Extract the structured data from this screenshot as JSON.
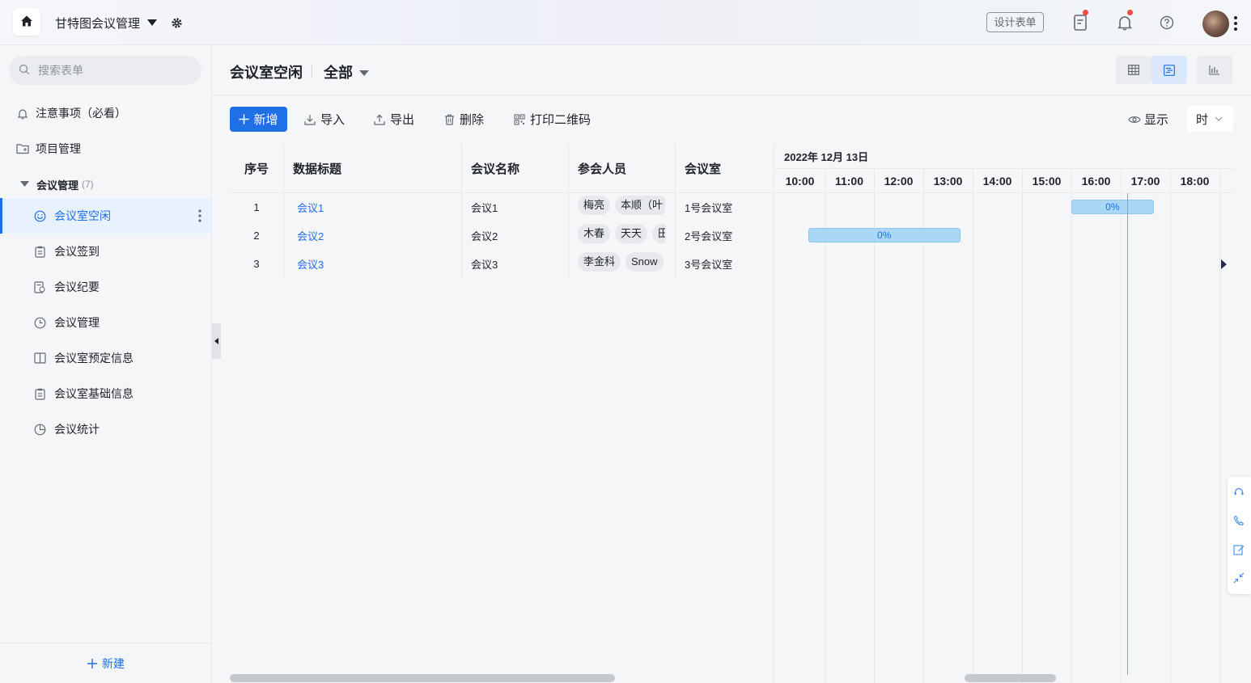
{
  "app": {
    "title": "甘特图会议管理",
    "design_form_label": "设计表单"
  },
  "sidebar": {
    "search_placeholder": "搜索表单",
    "top_items": [
      {
        "label": "注意事项（必看）",
        "icon": "bell-icon"
      },
      {
        "label": "项目管理",
        "icon": "folder-icon"
      }
    ],
    "group": {
      "label": "会议管理",
      "count": "(7)"
    },
    "items": [
      {
        "label": "会议室空闲",
        "icon": "smile-icon"
      },
      {
        "label": "会议签到",
        "icon": "clipboard-icon"
      },
      {
        "label": "会议纪要",
        "icon": "document-icon"
      },
      {
        "label": "会议管理",
        "icon": "clock-icon"
      },
      {
        "label": "会议室预定信息",
        "icon": "columns-icon"
      },
      {
        "label": "会议室基础信息",
        "icon": "clipboard-icon"
      },
      {
        "label": "会议统计",
        "icon": "pie-chart-icon"
      }
    ],
    "new_label": "新建"
  },
  "header": {
    "title": "会议室空闲",
    "view": "全部"
  },
  "toolbar": {
    "add": "新增",
    "import": "导入",
    "export": "导出",
    "delete": "删除",
    "print_qr": "打印二维码",
    "display": "显示",
    "time_unit": "时"
  },
  "table": {
    "columns": [
      "序号",
      "数据标题",
      "会议名称",
      "参会人员",
      "会议室"
    ],
    "rows": [
      {
        "no": "1",
        "title": "会议1",
        "meeting": "会议1",
        "attendees": [
          "梅亮",
          "本顺（叶"
        ],
        "room": "1号会议室"
      },
      {
        "no": "2",
        "title": "会议2",
        "meeting": "会议2",
        "attendees": [
          "木春",
          "天天",
          "田"
        ],
        "room": "2号会议室"
      },
      {
        "no": "3",
        "title": "会议3",
        "meeting": "会议3",
        "attendees": [
          "李金科",
          "Snow"
        ],
        "room": "3号会议室"
      }
    ]
  },
  "gantt": {
    "date": "2022年 12月 13日",
    "hours": [
      "10:00",
      "11:00",
      "12:00",
      "13:00",
      "14:00",
      "15:00",
      "16:00",
      "17:00",
      "18:00",
      "1"
    ],
    "bars": [
      {
        "row": 0,
        "start": "16:00",
        "end": "17:40",
        "progress": "0%"
      },
      {
        "row": 1,
        "start": "10:40",
        "end": "13:45",
        "progress": "0%"
      }
    ],
    "colors": {
      "bar": "#a9d8f7",
      "now_line": "#f08a4b",
      "accent": "#1f6fe5"
    }
  }
}
